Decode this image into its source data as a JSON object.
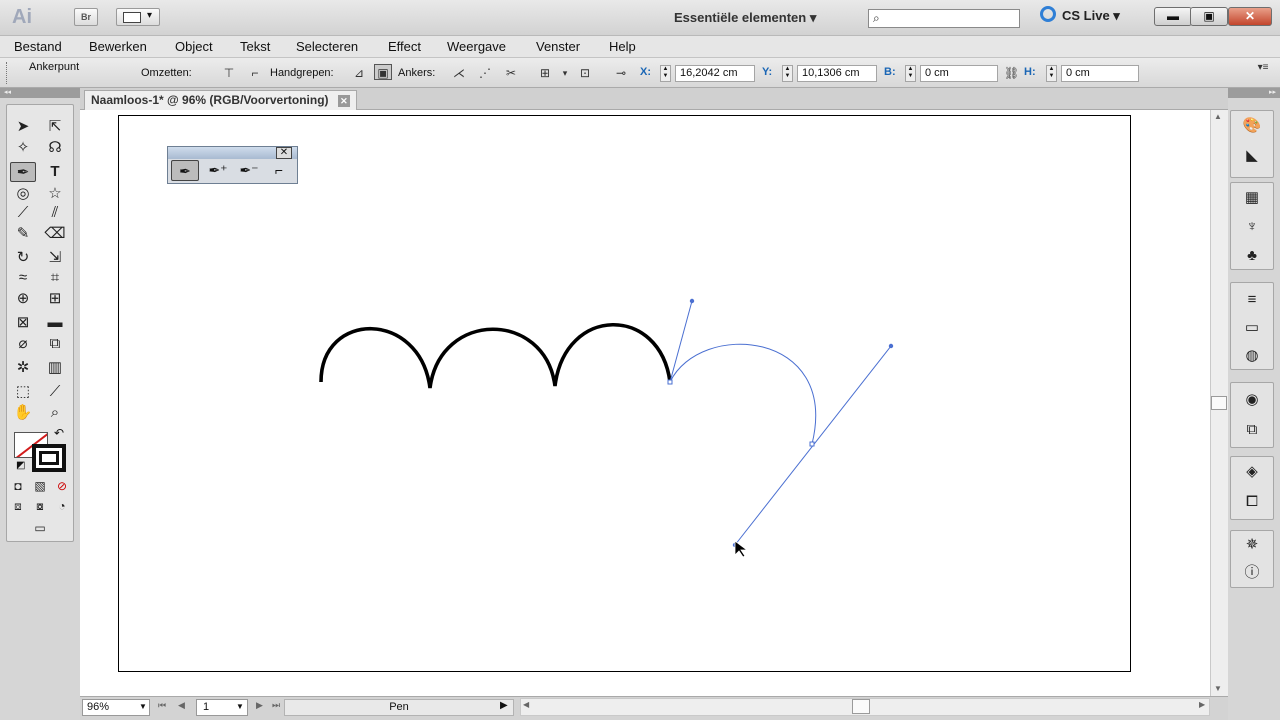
{
  "titlebar": {
    "app_logo": "Ai",
    "bridge": "Br",
    "workspace": "Essentiële elementen ▾",
    "cslive": "CS Live ▾",
    "win_min": "▬",
    "win_max": "▣",
    "win_close": "✕"
  },
  "menu": {
    "items": [
      "Bestand",
      "Bewerken",
      "Object",
      "Tekst",
      "Selecteren",
      "Effect",
      "Weergave",
      "Venster",
      "Help"
    ]
  },
  "controlbar": {
    "tool_label": "Ankerpunt",
    "convert_label": "Omzetten:",
    "handles_label": "Handgrepen:",
    "anchors_label": "Ankers:",
    "x_label": "X:",
    "x_value": "16,2042 cm",
    "y_label": "Y:",
    "y_value": "10,1306 cm",
    "w_label": "B:",
    "w_value": "0 cm",
    "h_label": "H:",
    "h_value": "0 cm"
  },
  "document": {
    "tab_title": "Naamloos-1* @ 96% (RGB/Voorvertoning)",
    "tab_close": "✕"
  },
  "statusbar": {
    "zoom": "96%",
    "page": "1",
    "current_tool": "Pen"
  },
  "colors": {
    "path_selected": "#4a6fd1",
    "path_stroke": "#000000",
    "artboard_bg": "#ffffff"
  },
  "icons": {
    "tools": [
      "selection-tool-icon",
      "direct-selection-tool-icon",
      "magic-wand-tool-icon",
      "lasso-tool-icon",
      "pen-tool-icon",
      "type-tool-icon",
      "spiral-tool-icon",
      "star-tool-icon",
      "paintbrush-tool-icon",
      "blob-brush-tool-icon",
      "pencil-tool-icon",
      "eraser-tool-icon",
      "rotate-tool-icon",
      "scale-tool-icon",
      "warp-tool-icon",
      "free-transform-tool-icon",
      "shape-builder-tool-icon",
      "perspective-grid-tool-icon",
      "mesh-tool-icon",
      "gradient-tool-icon",
      "eyedropper-tool-icon",
      "blend-tool-icon",
      "symbol-sprayer-tool-icon",
      "column-graph-tool-icon",
      "artboard-tool-icon",
      "slice-tool-icon",
      "hand-tool-icon",
      "zoom-tool-icon"
    ]
  }
}
